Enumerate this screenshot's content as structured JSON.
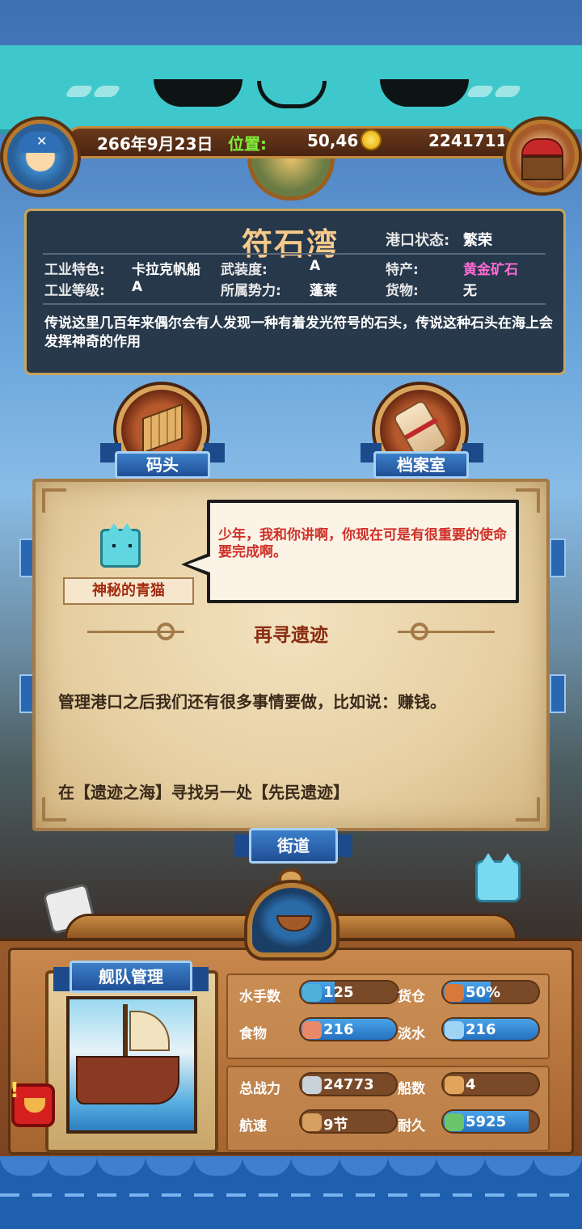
{
  "hud": {
    "date": "266年9月23日",
    "position_label": "位置:",
    "position_value": "50,46",
    "gold": "2241711"
  },
  "port": {
    "name": "符石湾",
    "status_label": "港口状态:",
    "status_value": "繁荣",
    "fields": {
      "industry_feature_label": "工业特色:",
      "industry_feature_value": "卡拉克帆船",
      "armament_label": "武装度:",
      "armament_value": "A",
      "specialty_label": "特产:",
      "specialty_value": "黄金矿石",
      "industry_level_label": "工业等级:",
      "industry_level_value": "A",
      "faction_label": "所属势力:",
      "faction_value": "蓬莱",
      "goods_label": "货物:",
      "goods_value": "无"
    },
    "description": "传说这里几百年来偶尔会有人发现一种有着发光符号的石头，传说这种石头在海上会发挥神奇的作用"
  },
  "buildings": {
    "dock_label": "码头",
    "archive_label": "档案室",
    "street_label": "街道"
  },
  "dialog": {
    "npc_name": "神秘的青猫",
    "speech": "少年，我和你讲啊，你现在可是有很重要的使命要完成啊。",
    "quest_title": "再寻遗迹",
    "quest_body": "管理港口之后我们还有很多事情要做，比如说：赚钱。",
    "quest_target": "在【遗迹之海】寻找另一处【先民遗迹】"
  },
  "fleet": {
    "title": "舰队管理",
    "sailors_label": "水手数",
    "sailors_value": "125",
    "sailors_fill": 0.35,
    "cargo_label": "货仓",
    "cargo_value": "50%",
    "cargo_fill": 0.5,
    "food_label": "食物",
    "food_value": "216",
    "food_fill": 1.0,
    "water_label": "淡水",
    "water_value": "216",
    "water_fill": 1.0,
    "power_label": "总战力",
    "power_value": "24773",
    "ships_label": "船数",
    "ships_value": "4",
    "speed_label": "航速",
    "speed_value": "9节",
    "durability_label": "耐久",
    "durability_value": "5925",
    "durability_fill": 0.9
  },
  "colors": {
    "accent_blue": "#2470c0",
    "position_green": "#7ef03a",
    "specialty_pink": "#ff6ad5",
    "speech_red": "#d0302a",
    "quest_title": "#8a2c10"
  }
}
